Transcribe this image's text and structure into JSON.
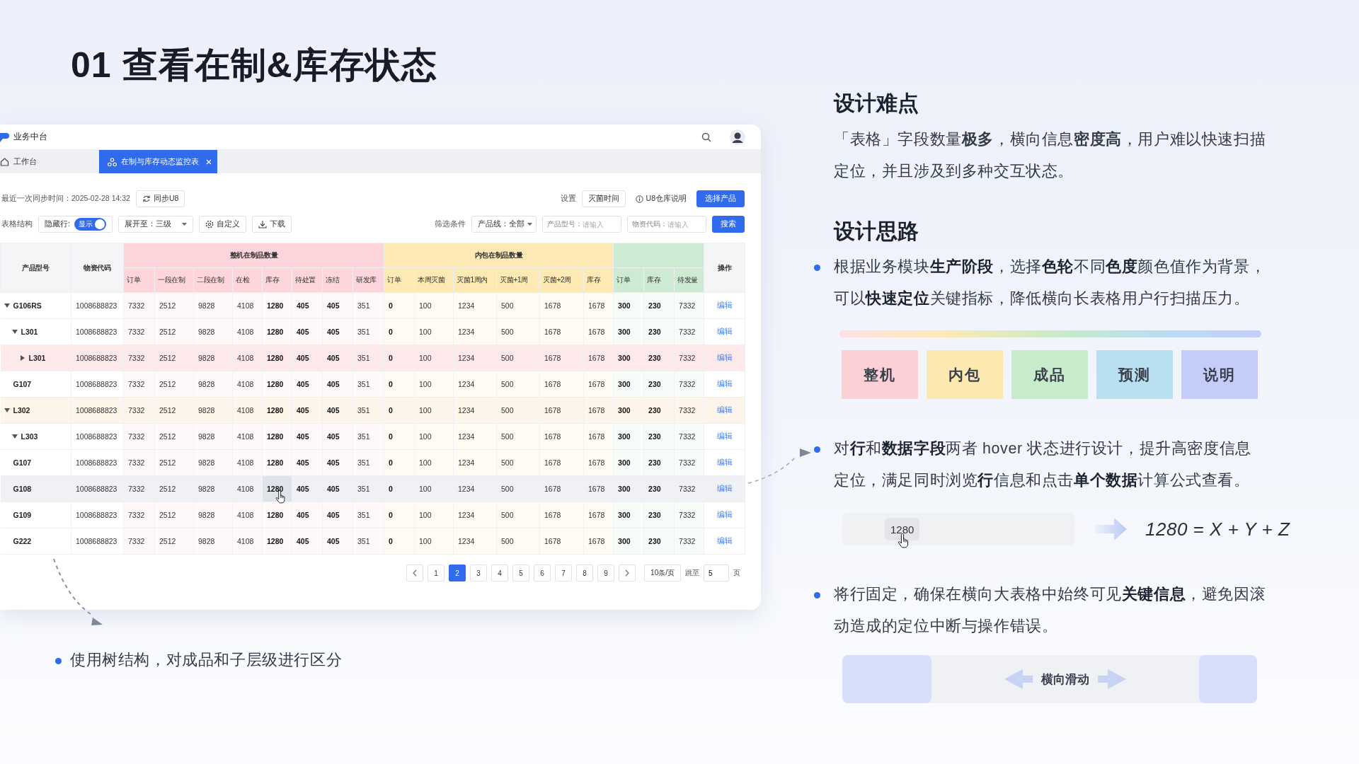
{
  "title": "01 查看在制&库存状态",
  "app": {
    "name": "业务中台",
    "tabs": [
      {
        "label": "工作台",
        "selected": false
      },
      {
        "label": "在制与库存动态监控表",
        "selected": true
      }
    ],
    "toolbar": {
      "sync_time": "最近一次同步时间：2025-02-28  14:32",
      "sync_button": "同步U8",
      "settings_label": "设置",
      "sterilize_button": "灭菌时间",
      "u8_link": "U8仓库说明",
      "select_button": "选择产品",
      "structure_label": "表格结构",
      "hidden_rows": {
        "label": "隐藏行:",
        "toggle_text": "显示",
        "on": true
      },
      "expand_select": "展开至：三级",
      "customize_button": "自定义",
      "download_button": "下载",
      "filter_label": "筛选条件",
      "product_line": "产品线：全部",
      "fields": [
        {
          "label": "产品型号：",
          "placeholder": "请输入"
        },
        {
          "label": "物资代码：",
          "placeholder": "请输入"
        }
      ],
      "search_button": "搜索"
    },
    "table": {
      "columns": [
        {
          "kind": "single",
          "label": "产品型号"
        },
        {
          "kind": "single",
          "label": "物资代码"
        },
        {
          "kind": "group",
          "title": "整机在制品数量",
          "color": "#fdd5da",
          "columns": [
            {
              "label": "订单",
              "bold": false,
              "hovered": false
            },
            {
              "label": "一段在制",
              "bold": false,
              "hovered": false
            },
            {
              "label": "二段在制",
              "bold": false,
              "hovered": false
            },
            {
              "label": "在检",
              "bold": false,
              "hovered": false
            },
            {
              "label": "库存",
              "bold": true,
              "hovered": true
            },
            {
              "label": "待处置",
              "bold": true,
              "hovered": false
            },
            {
              "label": "冻结",
              "bold": true,
              "hovered": false
            },
            {
              "label": "研发库",
              "bold": false,
              "hovered": false
            }
          ]
        },
        {
          "kind": "group",
          "title": "内包在制品数量",
          "color": "#fde9b4",
          "columns": [
            {
              "label": "订单",
              "bold": true,
              "hovered": false
            },
            {
              "label": "本周灭菌",
              "bold": false,
              "hovered": false
            },
            {
              "label": "灭菌1周内",
              "bold": false,
              "hovered": false
            },
            {
              "label": "灭菌+1周",
              "bold": false,
              "hovered": false
            },
            {
              "label": "灭菌+2周",
              "bold": false,
              "hovered": false
            },
            {
              "label": "库存",
              "bold": false,
              "hovered": false
            }
          ]
        },
        {
          "kind": "group",
          "color": "#cdebd2",
          "columns": [
            {
              "label": "订单",
              "bold": true,
              "hovered": false
            },
            {
              "label": "库存",
              "bold": true,
              "hovered": false
            },
            {
              "label": "待发量",
              "bold": false,
              "hovered": false
            }
          ]
        },
        {
          "kind": "single",
          "label": "操作"
        }
      ],
      "rows": [
        {
          "name": "G106RS",
          "kind": "group",
          "expanded": true,
          "hovered": false,
          "code": "1008688823",
          "values": [
            "7332",
            "2512",
            "9828",
            "4108",
            "1280",
            "405",
            "405",
            "351",
            "0",
            "100",
            "1234",
            "500",
            "1678",
            "1678",
            "300",
            "230",
            "7332"
          ],
          "action": "编辑",
          "children": [
            {
              "name": "L301",
              "kind": "group",
              "expanded": true,
              "hovered": false,
              "code": "1008688823",
              "values": [
                "7332",
                "2512",
                "9828",
                "4108",
                "1280",
                "405",
                "405",
                "351",
                "0",
                "100",
                "1234",
                "500",
                "1678",
                "1678",
                "300",
                "230",
                "7332"
              ],
              "action": "编辑",
              "children": [
                {
                  "name": "L301",
                  "kind": "group",
                  "expanded": false,
                  "hovered": false,
                  "color": "#fde8ea",
                  "code": "1008688823",
                  "values": [
                    "7332",
                    "2512",
                    "9828",
                    "4108",
                    "1280",
                    "405",
                    "405",
                    "351",
                    "0",
                    "100",
                    "1234",
                    "500",
                    "1678",
                    "1678",
                    "300",
                    "230",
                    "7332"
                  ],
                  "action": "编辑"
                }
              ]
            }
          ]
        },
        {
          "name": "G107",
          "kind": "leaf",
          "hovered": false,
          "code": "1008688823",
          "values": [
            "7332",
            "2512",
            "9828",
            "4108",
            "1280",
            "405",
            "405",
            "351",
            "0",
            "100",
            "1234",
            "500",
            "1678",
            "1678",
            "300",
            "230",
            "7332"
          ],
          "action": "编辑"
        },
        {
          "name": "L302",
          "kind": "group",
          "expanded": true,
          "hovered": false,
          "color": "#fdf4ea",
          "code": "1008688823",
          "values": [
            "7332",
            "2512",
            "9828",
            "4108",
            "1280",
            "405",
            "405",
            "351",
            "0",
            "100",
            "1234",
            "500",
            "1678",
            "1678",
            "300",
            "230",
            "7332"
          ],
          "action": "编辑",
          "children": [
            {
              "name": "L303",
              "kind": "group",
              "expanded": true,
              "hovered": false,
              "code": "1008688823",
              "values": [
                "7332",
                "2512",
                "9828",
                "4108",
                "1280",
                "405",
                "405",
                "351",
                "0",
                "100",
                "1234",
                "500",
                "1678",
                "1678",
                "300",
                "230",
                "7332"
              ],
              "action": "编辑"
            }
          ]
        },
        {
          "name": "G107",
          "kind": "leaf",
          "hovered": false,
          "code": "1008688823",
          "values": [
            "7332",
            "2512",
            "9828",
            "4108",
            "1280",
            "405",
            "405",
            "351",
            "0",
            "100",
            "1234",
            "500",
            "1678",
            "1678",
            "300",
            "230",
            "7332"
          ],
          "action": "编辑"
        },
        {
          "name": "G108",
          "kind": "leaf",
          "hovered": true,
          "code": "1008688823",
          "values": [
            "7332",
            "2512",
            "9828",
            "4108",
            "1280",
            "405",
            "405",
            "351",
            "0",
            "100",
            "1234",
            "500",
            "1678",
            "1678",
            "300",
            "230",
            "7332"
          ],
          "action": "编辑"
        },
        {
          "name": "G109",
          "kind": "leaf",
          "hovered": false,
          "code": "1008688823",
          "values": [
            "7332",
            "2512",
            "9828",
            "4108",
            "1280",
            "405",
            "405",
            "351",
            "0",
            "100",
            "1234",
            "500",
            "1678",
            "1678",
            "300",
            "230",
            "7332"
          ],
          "action": "编辑"
        },
        {
          "name": "G222",
          "kind": "leaf",
          "hovered": false,
          "code": "1008688823",
          "values": [
            "7332",
            "2512",
            "9828",
            "4108",
            "1280",
            "405",
            "405",
            "351",
            "0",
            "100",
            "1234",
            "500",
            "1678",
            "1678",
            "300",
            "230",
            "7332"
          ],
          "action": "编辑"
        }
      ]
    },
    "pagination": {
      "pages": [
        {
          "label": "1",
          "selected": false
        },
        {
          "label": "2",
          "selected": true
        },
        {
          "label": "3",
          "selected": false
        },
        {
          "label": "4",
          "selected": false
        },
        {
          "label": "5",
          "selected": false
        },
        {
          "label": "6",
          "selected": false
        },
        {
          "label": "7",
          "selected": false
        },
        {
          "label": "8",
          "selected": false
        },
        {
          "label": "9",
          "selected": false
        }
      ],
      "page_size": "10条/页",
      "jump_label": "跳至",
      "jump_value": "5",
      "page_unit": "页"
    }
  },
  "tree_note": "使用树结构，对成品和子层级进行区分",
  "difficulty": {
    "heading": "设计难点",
    "text": "「表格」字段数量**极多**，横向信息**密度高**，用户难以快速扫描定位，并且涉及到多种交互状态。"
  },
  "approach": {
    "heading": "设计思路",
    "points": [
      {
        "kind": "palette",
        "text": "根据业务模块**生产阶段**，选择**色轮**不同**色度**颜色值作为背景，可以**快速定位**关键指标，降低横向长表格用户行扫描压力。"
      },
      {
        "kind": "hover",
        "text": "对**行**和**数据字段**两者 hover 状态进行设计，提升高密度信息定位，满足同时浏览**行**信息和点击**单个数据**计算公式查看。"
      },
      {
        "kind": "scroll",
        "text": "将行固定，确保在横向大表格中始终可见**关键信息**，避免因滚动造成的定位中断与操作错误。"
      }
    ]
  },
  "palette": [
    {
      "label": "整机",
      "color": "#fdd0d6"
    },
    {
      "label": "内包",
      "color": "#fde8b0"
    },
    {
      "label": "成品",
      "color": "#c8ebcc"
    },
    {
      "label": "预测",
      "color": "#b8e0f0"
    },
    {
      "label": "说明",
      "color": "#c4cdfa"
    }
  ],
  "hover_demo": {
    "cell": "1280",
    "formula": "1280 = X + Y + Z"
  },
  "scroll_demo": {
    "label": "横向滑动"
  }
}
